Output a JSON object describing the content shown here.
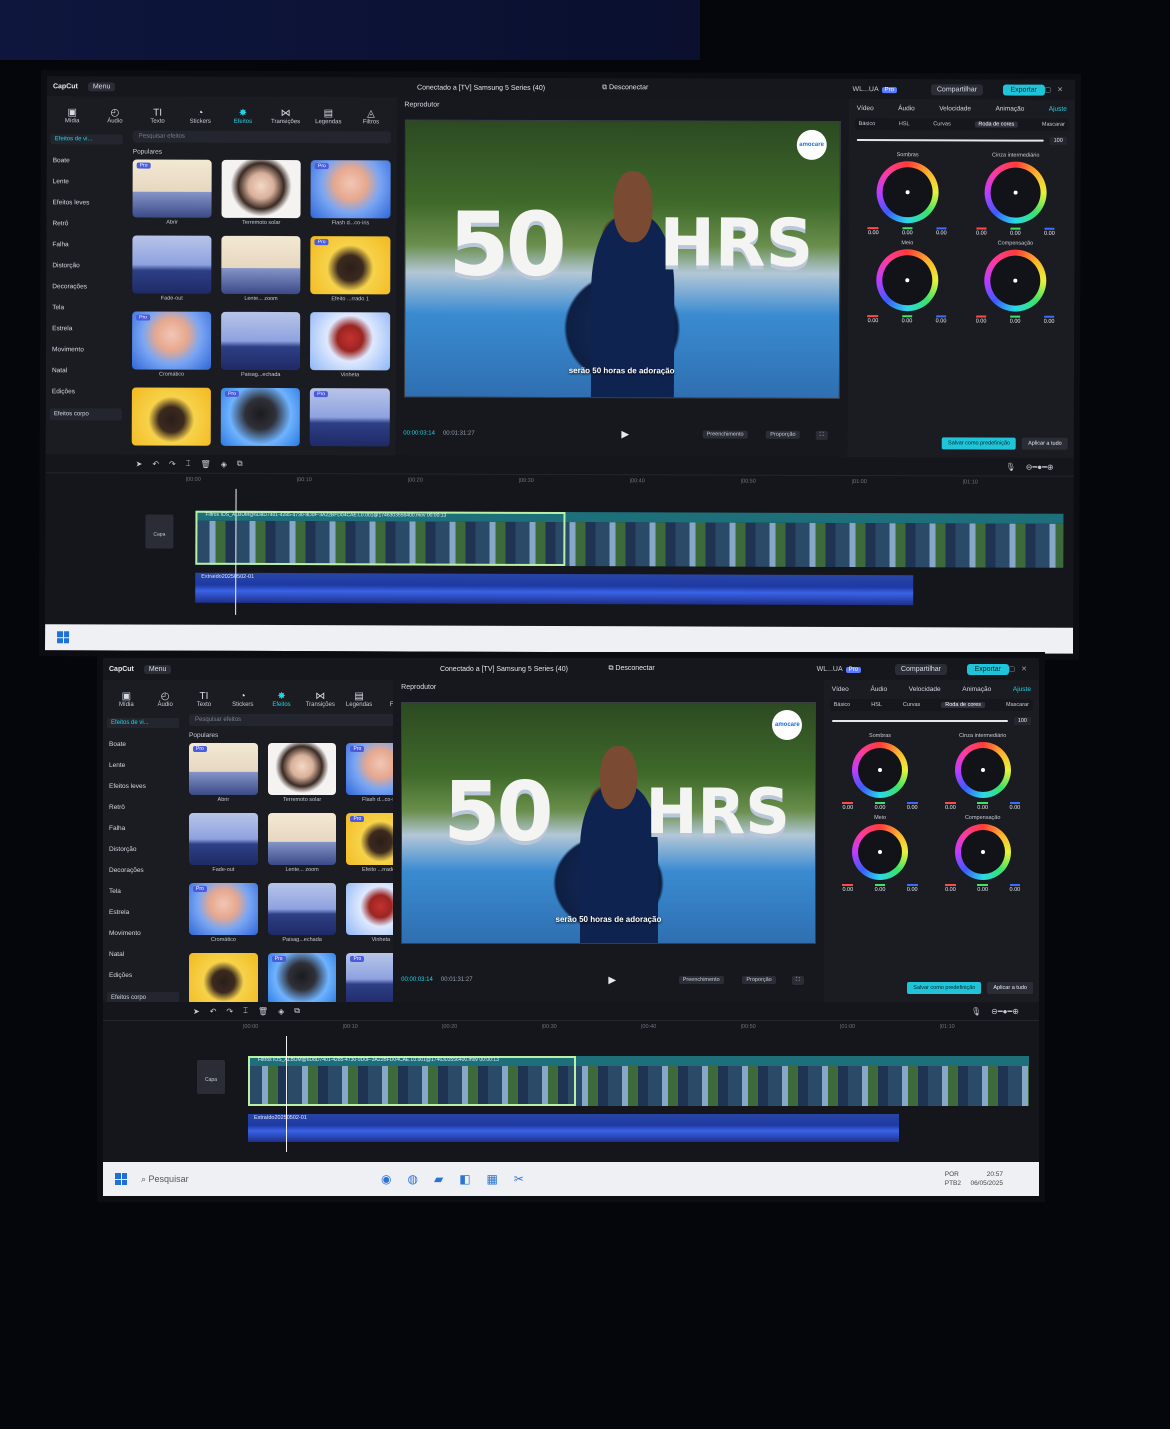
{
  "app": {
    "name": "CapCut",
    "menu": "Menu",
    "connection": "Conectado a [TV] Samsung 5 Series (40)",
    "disconnect": "Desconectar",
    "user": "WL...UA",
    "pro_badge": "Pro",
    "share": "Compartilhar",
    "export": "Exportar"
  },
  "toolbar": [
    {
      "label": "Mídia",
      "icon": "▣"
    },
    {
      "label": "Áudio",
      "icon": "◴"
    },
    {
      "label": "Texto",
      "icon": "TI"
    },
    {
      "label": "Stickers",
      "icon": "◔"
    },
    {
      "label": "Efeitos",
      "icon": "✸"
    },
    {
      "label": "Transições",
      "icon": "⋈"
    },
    {
      "label": "Legendas",
      "icon": "▤"
    },
    {
      "label": "Filtros",
      "icon": "◬"
    }
  ],
  "left_panel": {
    "category_dropdown": "Efeitos de vi...",
    "search_placeholder": "Pesquisar efeitos",
    "section": "Populares",
    "categories": [
      "Boate",
      "Lente",
      "Efeitos leves",
      "Retrô",
      "Falha",
      "Distorção",
      "Decorações",
      "Tela",
      "Estrela",
      "Movimento",
      "Natal",
      "Edições"
    ],
    "body_effects": "Efeitos corpo",
    "effects": [
      {
        "name": "Abrir",
        "pro": "Pro",
        "thumb": "t-sky"
      },
      {
        "name": "Terremoto solar",
        "pro": "",
        "thumb": "t-face"
      },
      {
        "name": "Flash d...co-íris",
        "pro": "Pro",
        "thumb": "t-blue"
      },
      {
        "name": "Fade-out",
        "pro": "",
        "thumb": "t-city"
      },
      {
        "name": "Lente... zoom",
        "pro": "",
        "thumb": "t-sky"
      },
      {
        "name": "Efeito ...rrado 1",
        "pro": "Pro",
        "thumb": "t-yellow"
      },
      {
        "name": "Cromático",
        "pro": "Pro",
        "thumb": "t-blue"
      },
      {
        "name": "Paisag...echada",
        "pro": "",
        "thumb": "t-city"
      },
      {
        "name": "Vinheta",
        "pro": "",
        "thumb": "t-red"
      },
      {
        "name": "",
        "pro": "",
        "thumb": "t-yellow"
      },
      {
        "name": "",
        "pro": "Pro",
        "thumb": "t-dark"
      },
      {
        "name": "",
        "pro": "Pro",
        "thumb": "t-city"
      }
    ]
  },
  "player": {
    "title": "Reprodutor",
    "overlay_big": "50",
    "overlay_hrs": "HRS",
    "caption": "serão 50 horas de adoração",
    "logo": "amocare",
    "current_time": "00:00:03:14",
    "total_time": "00:01:31:27",
    "btn_fill": "Preenchimento",
    "btn_ratio": "Proporção"
  },
  "right_panel": {
    "tabs": [
      "Vídeo",
      "Áudio",
      "Velocidade",
      "Animação",
      "Ajuste"
    ],
    "active_tab": "Ajuste",
    "subtabs": [
      "Básico",
      "HSL",
      "Curvas",
      "Roda de cores",
      "Mascarar"
    ],
    "active_subtab": "Roda de cores",
    "slider_value": "100",
    "wheels": [
      {
        "title": "Sombras",
        "values": [
          "0.00",
          "0.00",
          "0.00"
        ]
      },
      {
        "title": "Cinza intermediário",
        "values": [
          "0.00",
          "0.00",
          "0.00"
        ]
      },
      {
        "title": "Meio",
        "values": [
          "0.00",
          "0.00",
          "0.00"
        ]
      },
      {
        "title": "Compensação",
        "values": [
          "0.00",
          "0.00",
          "0.00"
        ]
      }
    ],
    "save_preset": "Salvar como predefinição",
    "apply_all": "Aplicar a tudo"
  },
  "timeline": {
    "ruler": [
      "|00:00",
      "|00:10",
      "|00:20",
      "|00:30",
      "|00:40",
      "|00:50",
      "|01:00",
      "|01:10"
    ],
    "video_clip": "Filtros IOS_ALBUM@6D8D7401-4285-4730-9D0F-3A22BFD04CAE.L0.001@1746303556400.mov 00:00:13",
    "audio_clip": "Extraído20250502-01",
    "cover": "Capa"
  },
  "taskbar": {
    "search": "Pesquisar",
    "lang": "POR\nPTB2",
    "time": "20:57",
    "date": "06/05/2025"
  }
}
